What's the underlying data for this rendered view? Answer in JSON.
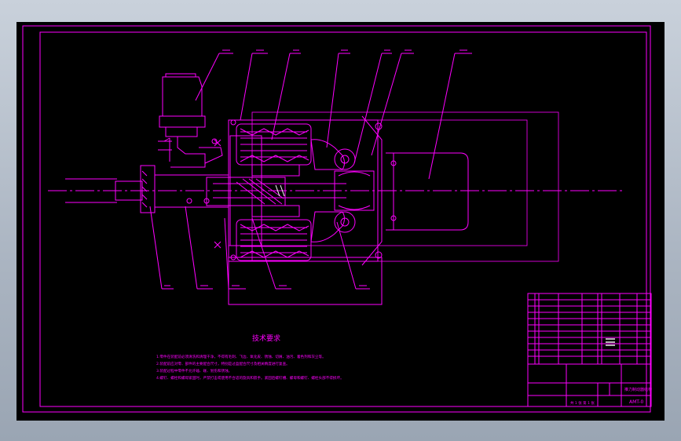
{
  "tech_requirements": {
    "title": "技术要求",
    "items": [
      "1.零件在装配前必须清洗和清理干净，不得有毛刺、飞边、氧化皮、锈蚀、切屑、油污、着色剂和灰尘等。",
      "2.装配前应对零、部件的主要配合尺寸，特别是过盈配合尺寸及相关精度进行复查。",
      "3.装配过程中零件不允许磕、碰、划伤和锈蚀。",
      "4.螺钉、螺栓和螺母紧固时，严禁打击或使用不合适的旋具和扳手。紧固后螺钉槽、螺母和螺钉、螺栓头部不得损坏。"
    ]
  },
  "title_block": {
    "drawing_title": "推力制动器结构",
    "drawing_number": "AMT-0",
    "sheet_info": "共 1 张  第 1 张"
  },
  "colors": {
    "background": "#000000",
    "lines": "#ff00ff",
    "highlight": "#ffffff",
    "centerline": "#ff00ff"
  }
}
